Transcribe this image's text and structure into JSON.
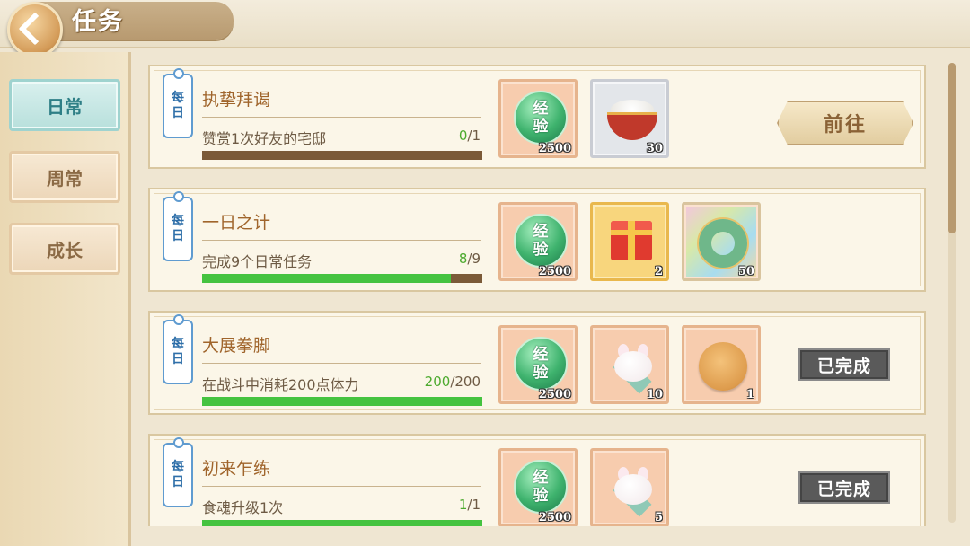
{
  "header": {
    "title": "任务"
  },
  "sidebar": {
    "tabs": [
      {
        "label": "日常",
        "active": true
      },
      {
        "label": "周常",
        "active": false
      },
      {
        "label": "成长",
        "active": false
      }
    ]
  },
  "tag_label": [
    "每",
    "日"
  ],
  "tasks": [
    {
      "name": "执挚拜谒",
      "desc": "赞赏1次好友的宅邸",
      "progress_current": "0",
      "progress_total": "/1",
      "progress_fraction": 0.0,
      "rewards": [
        {
          "icon": "exp-orb",
          "text": [
            "经",
            "验"
          ],
          "qty": "2500"
        },
        {
          "icon": "rice-bowl",
          "qty": "30"
        }
      ],
      "action": "前往",
      "status": "go"
    },
    {
      "name": "一日之计",
      "desc": "完成9个日常任务",
      "progress_current": "8",
      "progress_total": "/9",
      "progress_fraction": 0.889,
      "rewards": [
        {
          "icon": "exp-orb",
          "text": [
            "经",
            "验"
          ],
          "qty": "2500"
        },
        {
          "icon": "gift-box",
          "qty": "2"
        },
        {
          "icon": "jade-ring",
          "qty": "50"
        }
      ],
      "action": "",
      "status": "none"
    },
    {
      "name": "大展拳脚",
      "desc": "在战斗中消耗200点体力",
      "progress_current": "200",
      "progress_total": "/200",
      "progress_fraction": 1.0,
      "rewards": [
        {
          "icon": "exp-orb",
          "text": [
            "经",
            "验"
          ],
          "qty": "2500"
        },
        {
          "icon": "bunny-bun",
          "qty": "10"
        },
        {
          "icon": "round-cake",
          "qty": "1"
        }
      ],
      "action": "已完成",
      "status": "done"
    },
    {
      "name": "初来乍练",
      "desc": "食魂升级1次",
      "progress_current": "1",
      "progress_total": "/1",
      "progress_fraction": 1.0,
      "rewards": [
        {
          "icon": "exp-orb",
          "text": [
            "经",
            "验"
          ],
          "qty": "2500"
        },
        {
          "icon": "bunny-bun",
          "qty": "5"
        }
      ],
      "action": "已完成",
      "status": "done"
    }
  ],
  "colors": {
    "progress_fill": "#45c340",
    "progress_bg": "#7b5a38",
    "active_tab": "#2e7f86"
  }
}
